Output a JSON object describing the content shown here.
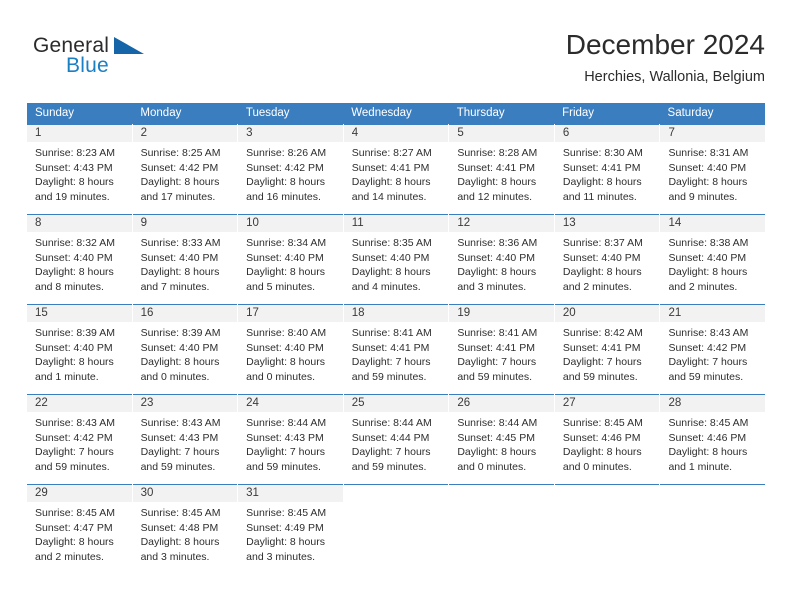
{
  "brand": {
    "name_part1": "General",
    "name_part2": "Blue",
    "flag_icon": "blue-triangle-flag-icon",
    "accent_color": "#1b7fc4"
  },
  "header": {
    "title": "December 2024",
    "subtitle": "Herchies, Wallonia, Belgium"
  },
  "theme": {
    "header_band_color": "#3b7ebf",
    "daynum_band_color": "#f2f2f2",
    "text_color": "#2e2e2e"
  },
  "weekdays": [
    "Sunday",
    "Monday",
    "Tuesday",
    "Wednesday",
    "Thursday",
    "Friday",
    "Saturday"
  ],
  "weeks": [
    [
      {
        "day": "1",
        "sunrise": "Sunrise: 8:23 AM",
        "sunset": "Sunset: 4:43 PM",
        "daylight_line1": "Daylight: 8 hours",
        "daylight_line2": "and 19 minutes."
      },
      {
        "day": "2",
        "sunrise": "Sunrise: 8:25 AM",
        "sunset": "Sunset: 4:42 PM",
        "daylight_line1": "Daylight: 8 hours",
        "daylight_line2": "and 17 minutes."
      },
      {
        "day": "3",
        "sunrise": "Sunrise: 8:26 AM",
        "sunset": "Sunset: 4:42 PM",
        "daylight_line1": "Daylight: 8 hours",
        "daylight_line2": "and 16 minutes."
      },
      {
        "day": "4",
        "sunrise": "Sunrise: 8:27 AM",
        "sunset": "Sunset: 4:41 PM",
        "daylight_line1": "Daylight: 8 hours",
        "daylight_line2": "and 14 minutes."
      },
      {
        "day": "5",
        "sunrise": "Sunrise: 8:28 AM",
        "sunset": "Sunset: 4:41 PM",
        "daylight_line1": "Daylight: 8 hours",
        "daylight_line2": "and 12 minutes."
      },
      {
        "day": "6",
        "sunrise": "Sunrise: 8:30 AM",
        "sunset": "Sunset: 4:41 PM",
        "daylight_line1": "Daylight: 8 hours",
        "daylight_line2": "and 11 minutes."
      },
      {
        "day": "7",
        "sunrise": "Sunrise: 8:31 AM",
        "sunset": "Sunset: 4:40 PM",
        "daylight_line1": "Daylight: 8 hours",
        "daylight_line2": "and 9 minutes."
      }
    ],
    [
      {
        "day": "8",
        "sunrise": "Sunrise: 8:32 AM",
        "sunset": "Sunset: 4:40 PM",
        "daylight_line1": "Daylight: 8 hours",
        "daylight_line2": "and 8 minutes."
      },
      {
        "day": "9",
        "sunrise": "Sunrise: 8:33 AM",
        "sunset": "Sunset: 4:40 PM",
        "daylight_line1": "Daylight: 8 hours",
        "daylight_line2": "and 7 minutes."
      },
      {
        "day": "10",
        "sunrise": "Sunrise: 8:34 AM",
        "sunset": "Sunset: 4:40 PM",
        "daylight_line1": "Daylight: 8 hours",
        "daylight_line2": "and 5 minutes."
      },
      {
        "day": "11",
        "sunrise": "Sunrise: 8:35 AM",
        "sunset": "Sunset: 4:40 PM",
        "daylight_line1": "Daylight: 8 hours",
        "daylight_line2": "and 4 minutes."
      },
      {
        "day": "12",
        "sunrise": "Sunrise: 8:36 AM",
        "sunset": "Sunset: 4:40 PM",
        "daylight_line1": "Daylight: 8 hours",
        "daylight_line2": "and 3 minutes."
      },
      {
        "day": "13",
        "sunrise": "Sunrise: 8:37 AM",
        "sunset": "Sunset: 4:40 PM",
        "daylight_line1": "Daylight: 8 hours",
        "daylight_line2": "and 2 minutes."
      },
      {
        "day": "14",
        "sunrise": "Sunrise: 8:38 AM",
        "sunset": "Sunset: 4:40 PM",
        "daylight_line1": "Daylight: 8 hours",
        "daylight_line2": "and 2 minutes."
      }
    ],
    [
      {
        "day": "15",
        "sunrise": "Sunrise: 8:39 AM",
        "sunset": "Sunset: 4:40 PM",
        "daylight_line1": "Daylight: 8 hours",
        "daylight_line2": "and 1 minute."
      },
      {
        "day": "16",
        "sunrise": "Sunrise: 8:39 AM",
        "sunset": "Sunset: 4:40 PM",
        "daylight_line1": "Daylight: 8 hours",
        "daylight_line2": "and 0 minutes."
      },
      {
        "day": "17",
        "sunrise": "Sunrise: 8:40 AM",
        "sunset": "Sunset: 4:40 PM",
        "daylight_line1": "Daylight: 8 hours",
        "daylight_line2": "and 0 minutes."
      },
      {
        "day": "18",
        "sunrise": "Sunrise: 8:41 AM",
        "sunset": "Sunset: 4:41 PM",
        "daylight_line1": "Daylight: 7 hours",
        "daylight_line2": "and 59 minutes."
      },
      {
        "day": "19",
        "sunrise": "Sunrise: 8:41 AM",
        "sunset": "Sunset: 4:41 PM",
        "daylight_line1": "Daylight: 7 hours",
        "daylight_line2": "and 59 minutes."
      },
      {
        "day": "20",
        "sunrise": "Sunrise: 8:42 AM",
        "sunset": "Sunset: 4:41 PM",
        "daylight_line1": "Daylight: 7 hours",
        "daylight_line2": "and 59 minutes."
      },
      {
        "day": "21",
        "sunrise": "Sunrise: 8:43 AM",
        "sunset": "Sunset: 4:42 PM",
        "daylight_line1": "Daylight: 7 hours",
        "daylight_line2": "and 59 minutes."
      }
    ],
    [
      {
        "day": "22",
        "sunrise": "Sunrise: 8:43 AM",
        "sunset": "Sunset: 4:42 PM",
        "daylight_line1": "Daylight: 7 hours",
        "daylight_line2": "and 59 minutes."
      },
      {
        "day": "23",
        "sunrise": "Sunrise: 8:43 AM",
        "sunset": "Sunset: 4:43 PM",
        "daylight_line1": "Daylight: 7 hours",
        "daylight_line2": "and 59 minutes."
      },
      {
        "day": "24",
        "sunrise": "Sunrise: 8:44 AM",
        "sunset": "Sunset: 4:43 PM",
        "daylight_line1": "Daylight: 7 hours",
        "daylight_line2": "and 59 minutes."
      },
      {
        "day": "25",
        "sunrise": "Sunrise: 8:44 AM",
        "sunset": "Sunset: 4:44 PM",
        "daylight_line1": "Daylight: 7 hours",
        "daylight_line2": "and 59 minutes."
      },
      {
        "day": "26",
        "sunrise": "Sunrise: 8:44 AM",
        "sunset": "Sunset: 4:45 PM",
        "daylight_line1": "Daylight: 8 hours",
        "daylight_line2": "and 0 minutes."
      },
      {
        "day": "27",
        "sunrise": "Sunrise: 8:45 AM",
        "sunset": "Sunset: 4:46 PM",
        "daylight_line1": "Daylight: 8 hours",
        "daylight_line2": "and 0 minutes."
      },
      {
        "day": "28",
        "sunrise": "Sunrise: 8:45 AM",
        "sunset": "Sunset: 4:46 PM",
        "daylight_line1": "Daylight: 8 hours",
        "daylight_line2": "and 1 minute."
      }
    ],
    [
      {
        "day": "29",
        "sunrise": "Sunrise: 8:45 AM",
        "sunset": "Sunset: 4:47 PM",
        "daylight_line1": "Daylight: 8 hours",
        "daylight_line2": "and 2 minutes."
      },
      {
        "day": "30",
        "sunrise": "Sunrise: 8:45 AM",
        "sunset": "Sunset: 4:48 PM",
        "daylight_line1": "Daylight: 8 hours",
        "daylight_line2": "and 3 minutes."
      },
      {
        "day": "31",
        "sunrise": "Sunrise: 8:45 AM",
        "sunset": "Sunset: 4:49 PM",
        "daylight_line1": "Daylight: 8 hours",
        "daylight_line2": "and 3 minutes."
      },
      {
        "day": "",
        "sunrise": "",
        "sunset": "",
        "daylight_line1": "",
        "daylight_line2": ""
      },
      {
        "day": "",
        "sunrise": "",
        "sunset": "",
        "daylight_line1": "",
        "daylight_line2": ""
      },
      {
        "day": "",
        "sunrise": "",
        "sunset": "",
        "daylight_line1": "",
        "daylight_line2": ""
      },
      {
        "day": "",
        "sunrise": "",
        "sunset": "",
        "daylight_line1": "",
        "daylight_line2": ""
      }
    ]
  ]
}
